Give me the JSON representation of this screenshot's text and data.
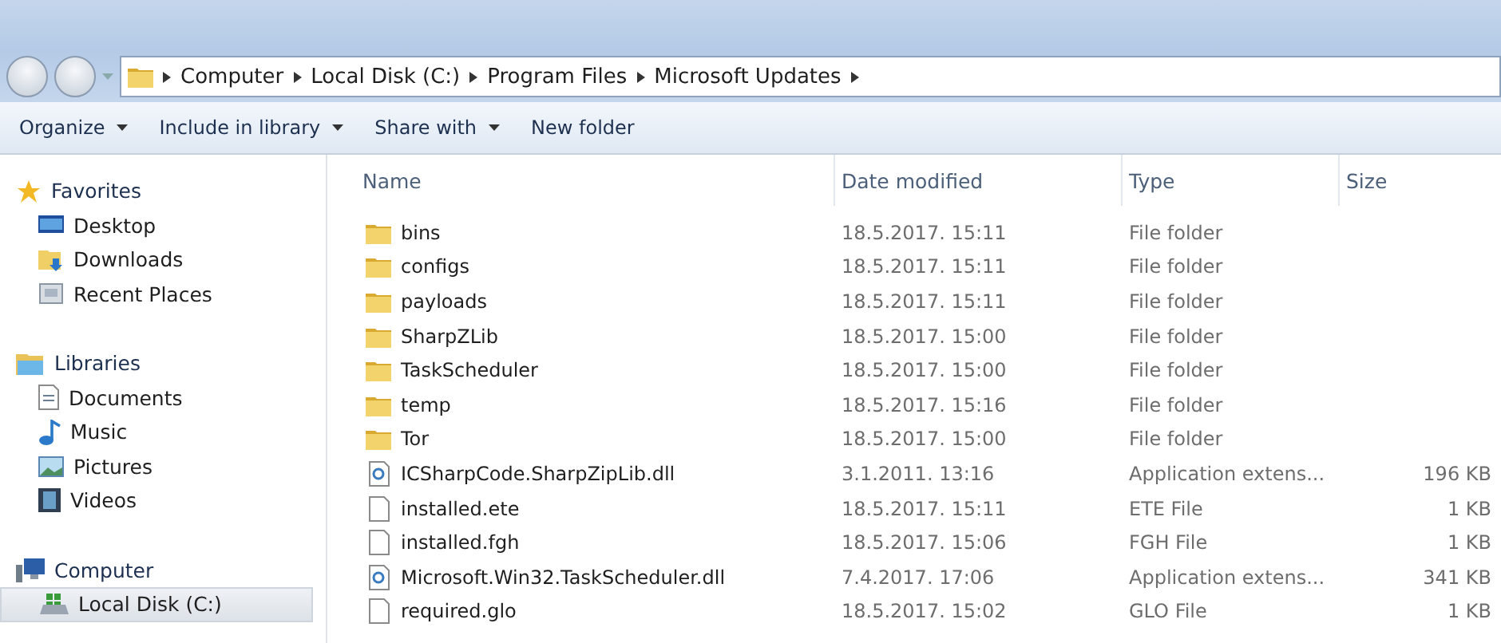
{
  "address_bar": {
    "crumbs": [
      "Computer",
      "Local Disk (C:)",
      "Program Files",
      "Microsoft Updates"
    ]
  },
  "toolbar": {
    "items": [
      {
        "label": "Organize",
        "dropdown": true
      },
      {
        "label": "Include in library",
        "dropdown": true
      },
      {
        "label": "Share with",
        "dropdown": true
      },
      {
        "label": "New folder",
        "dropdown": false
      }
    ]
  },
  "sidebar": {
    "groups": [
      {
        "label": "Favorites",
        "kind": "star",
        "items": [
          {
            "label": "Desktop",
            "kind": "desktop",
            "selected": false
          },
          {
            "label": "Downloads",
            "kind": "downloads",
            "selected": false
          },
          {
            "label": "Recent Places",
            "kind": "recent",
            "selected": false
          }
        ]
      },
      {
        "label": "Libraries",
        "kind": "library",
        "items": [
          {
            "label": "Documents",
            "kind": "document",
            "selected": false
          },
          {
            "label": "Music",
            "kind": "music",
            "selected": false
          },
          {
            "label": "Pictures",
            "kind": "pictures",
            "selected": false
          },
          {
            "label": "Videos",
            "kind": "videos",
            "selected": false
          }
        ]
      },
      {
        "label": "Computer",
        "kind": "computer",
        "items": [
          {
            "label": "Local Disk (C:)",
            "kind": "disk",
            "selected": true
          }
        ]
      }
    ]
  },
  "table": {
    "columns": [
      "Name",
      "Date modified",
      "Type",
      "Size"
    ],
    "rows": [
      {
        "kind": "folder",
        "name": "bins",
        "date": "18.5.2017. 15:11",
        "type": "File folder"
      },
      {
        "kind": "folder",
        "name": "configs",
        "date": "18.5.2017. 15:11",
        "type": "File folder"
      },
      {
        "kind": "folder",
        "name": "payloads",
        "date": "18.5.2017. 15:11",
        "type": "File folder"
      },
      {
        "kind": "folder",
        "name": "SharpZLib",
        "date": "18.5.2017. 15:00",
        "type": "File folder"
      },
      {
        "kind": "folder",
        "name": "TaskScheduler",
        "date": "18.5.2017. 15:00",
        "type": "File folder"
      },
      {
        "kind": "folder",
        "name": "temp",
        "date": "18.5.2017. 15:16",
        "type": "File folder"
      },
      {
        "kind": "folder",
        "name": "Tor",
        "date": "18.5.2017. 15:00",
        "type": "File folder"
      },
      {
        "kind": "dll",
        "name": "ICSharpCode.SharpZipLib.dll",
        "date": "3.1.2011. 13:16",
        "type": "Application extens...",
        "size": "196 KB"
      },
      {
        "kind": "file",
        "name": "installed.ete",
        "date": "18.5.2017. 15:11",
        "type": "ETE File",
        "size": "1 KB"
      },
      {
        "kind": "file",
        "name": "installed.fgh",
        "date": "18.5.2017. 15:06",
        "type": "FGH File",
        "size": "1 KB"
      },
      {
        "kind": "dll",
        "name": "Microsoft.Win32.TaskScheduler.dll",
        "date": "7.4.2017. 17:06",
        "type": "Application extens...",
        "size": "341 KB"
      },
      {
        "kind": "file",
        "name": "required.glo",
        "date": "18.5.2017. 15:02",
        "type": "GLO File",
        "size": "1 KB"
      }
    ]
  }
}
